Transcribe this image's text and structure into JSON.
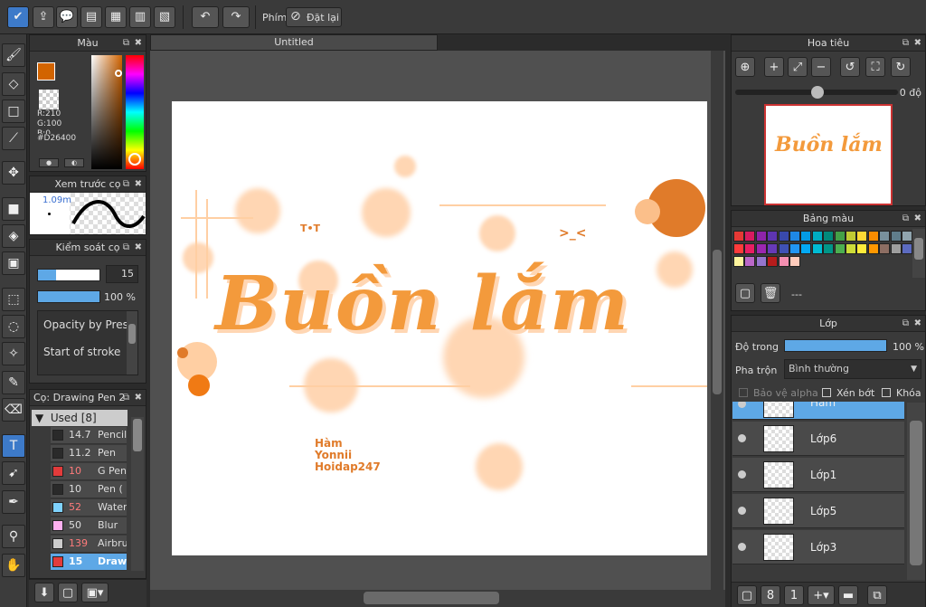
{
  "toolbar": {
    "shortcut_label": "Phím",
    "reset_label": "Đặt lại"
  },
  "doc": {
    "title": "Untitled"
  },
  "color_panel": {
    "title": "Màu",
    "r": "R:210",
    "g": "G:100",
    "b": "B:0",
    "hex": "#D26400",
    "fg_color": "#D26400"
  },
  "brush_preview": {
    "title": "Xem trước cọ",
    "size": "1.09m"
  },
  "brush_control": {
    "title": "Kiểm soát cọ",
    "size_value": "15",
    "opacity_value": "100 %",
    "size_fraction": 0.3,
    "opacity_fraction": 1.0,
    "options": [
      "Opacity by Pressure",
      "Start of stroke"
    ]
  },
  "brush_list": {
    "title": "Cọ: Drawing Pen 2",
    "group": "Used [8]",
    "items": [
      {
        "size": "14.7",
        "name": "Pencil",
        "color": "#2a2a2a",
        "red": false
      },
      {
        "size": "11.2",
        "name": "Pen",
        "color": "#2a2a2a",
        "red": false
      },
      {
        "size": "10",
        "name": "G Pen",
        "color": "#e23b3b",
        "red": true
      },
      {
        "size": "10",
        "name": "Pen (",
        "color": "#2a2a2a",
        "red": false
      },
      {
        "size": "52",
        "name": "Water",
        "color": "#7fd3ff",
        "red": true
      },
      {
        "size": "50",
        "name": "Blur",
        "color": "#ffb0f0",
        "red": false
      },
      {
        "size": "139",
        "name": "Airbru",
        "color": "#cccccc",
        "red": true
      },
      {
        "size": "15",
        "name": "Drawi",
        "color": "#e23b3b",
        "red": false
      }
    ]
  },
  "navigator": {
    "title": "Hoa tiêu",
    "rotation": "0 độ"
  },
  "palette": {
    "title": "Bảng màu",
    "value": "---",
    "colors": [
      "#e53935",
      "#d81b60",
      "#8e24aa",
      "#5e35b1",
      "#3949ab",
      "#1e88e5",
      "#039be5",
      "#00acc1",
      "#00897b",
      "#43a047",
      "#c0ca33",
      "#fdd835",
      "#fb8c00",
      "#78909c",
      "#607d8b",
      "#90a4ae",
      "#ff3b3b",
      "#e91e63",
      "#9c27b0",
      "#673ab7",
      "#3f51b5",
      "#2196f3",
      "#03a9f4",
      "#00bcd4",
      "#009688",
      "#4caf50",
      "#cddc39",
      "#ffeb3b",
      "#ff9800",
      "#8d6e63",
      "#9e9e9e",
      "#5c6bc0",
      "#fff59d",
      "#ba68c8",
      "#9575cd",
      "#b71c1c",
      "#f48fb1",
      "#ffccbc"
    ]
  },
  "layer_panel": {
    "title": "Lớp",
    "opacity_label": "Độ trong",
    "opacity_value": "100 %",
    "opacity_fraction": 1.0,
    "blend_label": "Pha trộn",
    "blend_value": "Bình thường",
    "protect_alpha": "Bảo vệ alpha",
    "clipping": "Xén bớt",
    "lock": "Khóa",
    "layers": [
      {
        "name": "Hàm",
        "selected": true
      },
      {
        "name": "Lớp6",
        "selected": false
      },
      {
        "name": "Lớp1",
        "selected": false
      },
      {
        "name": "Lớp5",
        "selected": false
      },
      {
        "name": "Lớp3",
        "selected": false
      }
    ]
  },
  "artwork": {
    "main_text": "Buồn lắm",
    "emote_1": "T•T",
    "emote_2": ">_<",
    "credit_1": "Hàm",
    "credit_2": "Yonnii",
    "credit_3": "Hoidap247"
  }
}
